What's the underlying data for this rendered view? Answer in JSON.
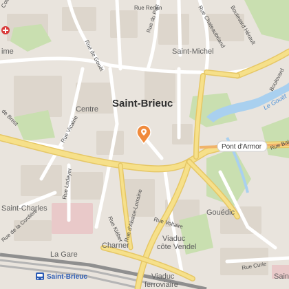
{
  "map": {
    "city": "Saint-Brieuc",
    "districts": [
      "Centre",
      "Saint-Michel",
      "Saint-Charles",
      "Gouédic",
      "Charner",
      "La Gare"
    ],
    "streets": {
      "rue_renan": "Rue Renan",
      "rue_du_port": "Rue du Port",
      "rue_chateaubriand": "Rue Chateaubriand",
      "boulevard_herault": "Boulevard Hérault",
      "rue_de_gouet": "Rue de Gouët",
      "rue_vicairie": "Rue Vicairie",
      "rue_de_brest": "de Brest",
      "rue_ledeyer": "Rue Ledeyer",
      "rue_kleber": "Rue Kléber",
      "rue_alsace": "Rue d'Alsace-Lorraine",
      "rue_voltaire": "Rue Voltaire",
      "rue_cordiere": "Rue de la Cordière",
      "rue_curie": "Rue Curie",
      "rue_balzac": "Rue Balz",
      "rue_colbert": "Colbert",
      "boulevard_east": "Boulevard",
      "rue_ime": "ime",
      "saint_top": "Saint"
    },
    "places": {
      "pont_darmor": "Pont d'Armor",
      "viaduc_vendel": "Viaduc côte Vendel",
      "viaduc_vendel_l1": "Viaduc",
      "viaduc_vendel_l2": "côte Vendel",
      "viaduc_ferroviaire_l1": "Viaduc",
      "viaduc_ferroviaire_l2": "ferroviaire",
      "station": "Saint-Brieuc",
      "river": "Le Gouët"
    },
    "icons": [
      "location-pin-icon",
      "hospital-icon",
      "train-icon"
    ],
    "colors": {
      "pin": "#f08a3c",
      "river": "#a9d0ef",
      "park": "#c9dfb0",
      "road_main": "#f6e08a",
      "road_secondary": "#ffffff",
      "rail": "#8f8f8f",
      "station_text": "#2b5bb4",
      "hospital": "#d93a3a"
    }
  }
}
